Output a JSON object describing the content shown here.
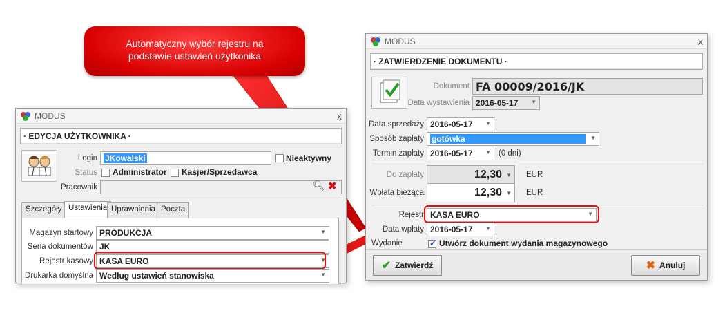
{
  "callout": {
    "line1": "Automatyczny wybór rejestru na",
    "line2": "podstawie ustawień użytkonika"
  },
  "left": {
    "title": "MODUS",
    "close": "x",
    "section": "· EDYCJA UŻYTKOWNIKA ·",
    "login_label": "Login",
    "login_value": "JKowalski",
    "inactive_label": "Nieaktywny",
    "status_label": "Status",
    "admin_label": "Administrator",
    "cashier_label": "Kasjer/Sprzedawca",
    "employee_label": "Pracownik",
    "tabs": [
      "Szczegóły",
      "Ustawienia",
      "Uprawnienia",
      "Poczta"
    ],
    "fields": [
      {
        "label": "Magazyn startowy",
        "value": "PRODUKCJA"
      },
      {
        "label": "Seria dokumentów",
        "value": "JK"
      },
      {
        "label": "Rejestr kasowy",
        "value": "KASA EURO"
      },
      {
        "label": "Drukarka domyślna",
        "value": "Według ustawień stanowiska"
      }
    ]
  },
  "right": {
    "title": "MODUS",
    "close": "x",
    "section": "· ZATWIERDZENIE DOKUMENTU ·",
    "doc_label": "Dokument",
    "doc_value": "FA 00009/2016/JK",
    "issue_label": "Data wystawienia",
    "issue_value": "2016-05-17",
    "sale_label": "Data sprzedaży",
    "sale_value": "2016-05-17",
    "pay_label": "Sposób zapłaty",
    "pay_value": "gotówka",
    "term_label": "Termin zapłaty",
    "term_value": "2016-05-17",
    "term_days": "(0 dni)",
    "due_label": "Do zapłaty",
    "due_value": "12,30",
    "due_currency": "EUR",
    "paid_label": "Wpłata bieżąca",
    "paid_value": "12,30",
    "paid_currency": "EUR",
    "reg_label": "Rejestr",
    "reg_value": "KASA EURO",
    "paydate_label": "Data wpłaty",
    "paydate_value": "2016-05-17",
    "issue2_label": "Wydanie",
    "issue2_check": "Utwórz dokument wydania magazynowego",
    "ok_label": "Zatwierdź",
    "cancel_label": "Anuluj"
  },
  "colors": {
    "highlight": "#e01010",
    "callout": "#d80000",
    "selection": "#3399ff"
  },
  "icons": [
    "modus-logo-icon",
    "users-icon",
    "search-icon",
    "delete-icon",
    "document-check-icon",
    "checkmark-icon",
    "cancel-icon"
  ]
}
